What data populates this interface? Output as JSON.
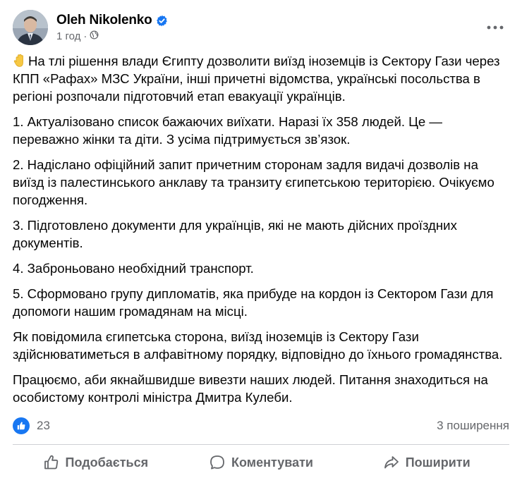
{
  "post": {
    "author": "Oleh Nikolenko",
    "timestamp": "1 год",
    "audience_icon": "globe-icon",
    "verified_icon": "verified-badge-icon",
    "more_icon": "more-options-icon",
    "emoji_icon": "raised-hand-emoji",
    "paragraphs": [
      "На тлі рішення влади Єгипту дозволити виїзд іноземців із Сектору Гази через КПП «Рафах» МЗС України, інші причетні відомства, українські посольства в регіоні розпочали підготовчий етап евакуації українців.",
      "1. Актуалізовано список бажаючих виїхати. Наразі їх 358 людей. Це — переважно жінки та діти. З усіма підтримується зв’язок.",
      "2. Надіслано офіційний запит причетним сторонам задля видачі дозволів на виїзд із палестинського анклаву та транзиту єгипетською територією. Очікуємо погодження.",
      "3. Підготовлено документи для українців, які не мають дійсних проїздних документів.",
      "4. Заброньовано необхідний транспорт.",
      "5. Сформовано групу дипломатів, яка прибуде на кордон із Сектором Гази для допомоги нашим громадянам на місці.",
      "Як повідомила єгипетська сторона, виїзд іноземців із Сектору Гази здійснюватиметься в алфавітному порядку, відповідно до їхнього громадянства.",
      "Працюємо, аби якнайшвидше вивезти наших людей. Питання знаходиться на особистому контролі міністра Дмитра Кулеби."
    ]
  },
  "reactions": {
    "count": "23",
    "shares": "3 поширення",
    "icon": "like-reaction-icon"
  },
  "actions": {
    "like_label": "Подобається",
    "comment_label": "Коментувати",
    "share_label": "Поширити"
  },
  "colors": {
    "text": "#050505",
    "secondary": "#65676b",
    "accent": "#1877f2",
    "divider": "#ced0d4"
  }
}
